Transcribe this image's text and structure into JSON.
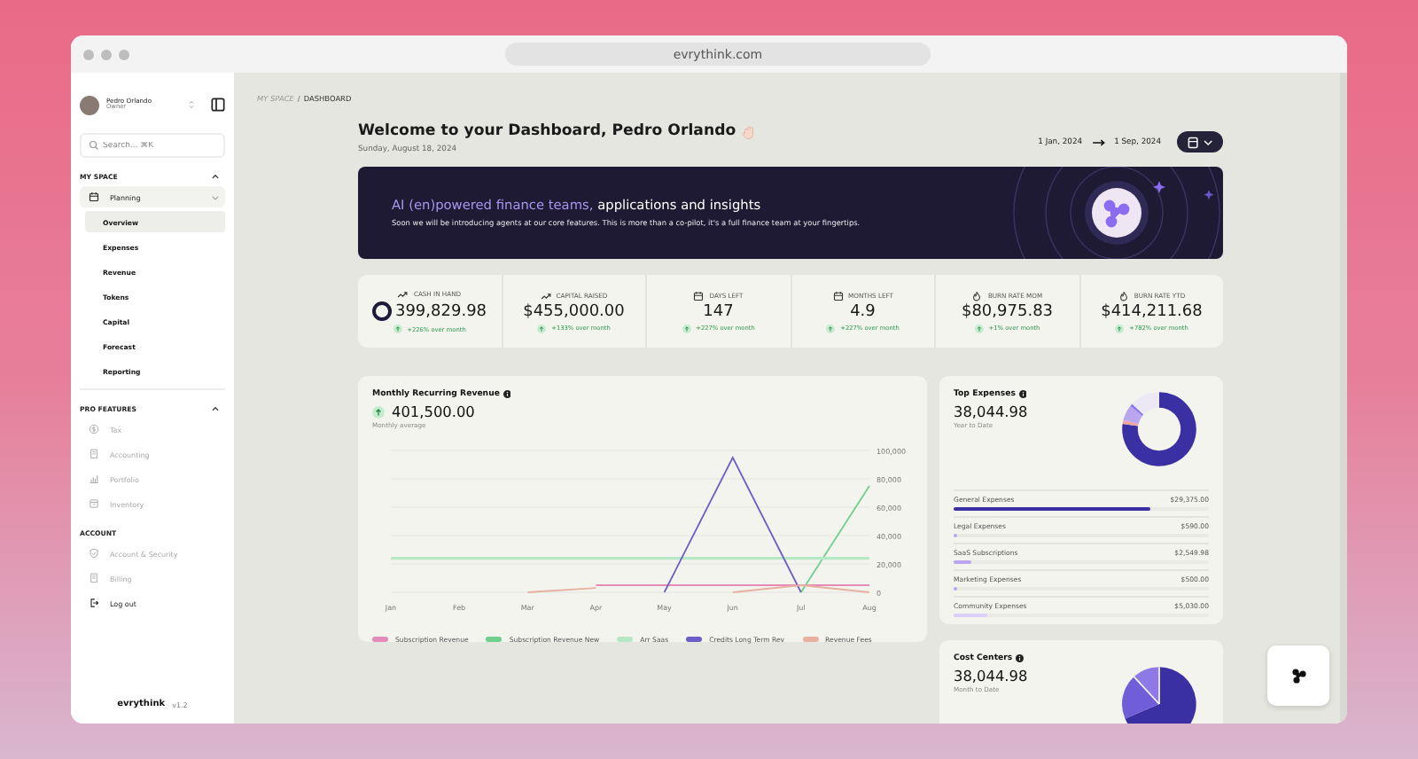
{
  "browser": {
    "url": "evrythink.com"
  },
  "sidebar": {
    "user": {
      "name": "Pedro Orlando",
      "role": "Owner"
    },
    "search": {
      "placeholder": "Search... ⌘K"
    },
    "sections": [
      {
        "title": "MY SPACE",
        "expanded": true,
        "items": [
          {
            "label": "Planning",
            "disabled": false,
            "expanded": true,
            "children": [
              {
                "label": "Overview",
                "selected": true
              },
              {
                "label": "Expenses",
                "selected": false
              },
              {
                "label": "Revenue",
                "selected": false
              },
              {
                "label": "Tokens",
                "selected": false
              },
              {
                "label": "Capital",
                "selected": false
              },
              {
                "label": "Forecast",
                "selected": false
              },
              {
                "label": "Reporting",
                "selected": false
              }
            ]
          }
        ]
      },
      {
        "title": "PRO FEATURES",
        "expanded": true,
        "items": [
          {
            "label": "Tax",
            "disabled": true
          },
          {
            "label": "Accounting",
            "disabled": true
          },
          {
            "label": "Portfolio",
            "disabled": true
          },
          {
            "label": "Inventory",
            "disabled": true
          }
        ]
      },
      {
        "title": "ACCOUNT",
        "items": [
          {
            "label": "Account & Security",
            "disabled": true
          },
          {
            "label": "Billing",
            "disabled": true
          },
          {
            "label": "Log out",
            "disabled": false
          }
        ]
      }
    ],
    "footer": {
      "logo": "evrythink",
      "version": "v1.2"
    }
  },
  "breadcrumb": {
    "separator": "/",
    "items": [
      {
        "label": "MY SPACE",
        "current": false
      },
      {
        "label": "DASHBOARD",
        "current": true
      }
    ]
  },
  "header": {
    "title": "Welcome to your Dashboard, Pedro Orlando",
    "date": "Sunday, August 18, 2024",
    "range_start": "1 Jan, 2024",
    "range_end": "1 Sep, 2024"
  },
  "banner": {
    "title_accent": "AI (en)powered finance teams,",
    "title_rest": "applications and insights",
    "text": "Soon we will be introducing agents at our core features. This is more than a co-pilot, it's a full finance team at your fingertips."
  },
  "stats": [
    {
      "label": "CASH IN HAND",
      "value": "399,829.98",
      "change": "+226% over month",
      "cursor": true
    },
    {
      "label": "CAPITAL RAISED",
      "value": "$455,000.00",
      "change": "+133% over month"
    },
    {
      "label": "DAYS LEFT",
      "value": "147",
      "change": "+227% over month"
    },
    {
      "label": "MONTHS LEFT",
      "value": "4.9",
      "change": "+227% over month"
    },
    {
      "label": "BURN RATE MOM",
      "value": "$80,975.83",
      "change": "+1% over month"
    },
    {
      "label": "BURN RATE YTD",
      "value": "$414,211.68",
      "change": "+782% over month"
    }
  ],
  "mrr": {
    "title": "Monthly Recurring Revenue",
    "value": "401,500.00",
    "subtitle": "Monthly average",
    "chart_data": {
      "type": "line",
      "grid": true,
      "categories": [
        "Jan",
        "Feb",
        "Mar",
        "Apr",
        "May",
        "Jun",
        "Jul",
        "Aug"
      ],
      "ylim": [
        0,
        100000
      ],
      "yticks": [
        0,
        {
          "value": 20000,
          "label": "20,000"
        },
        {
          "value": 40000,
          "label": "40,000"
        },
        {
          "value": 60000,
          "label": "60,000"
        },
        {
          "value": 80000,
          "label": "80,000"
        },
        {
          "value": 100000,
          "label": "100,000"
        }
      ],
      "series": [
        {
          "name": "Subscription Revenue",
          "color": "#e58bb8",
          "values": [
            null,
            null,
            null,
            5000,
            5000,
            5000,
            5000,
            5000
          ]
        },
        {
          "name": "Subscription Revenue New",
          "color": "#6fcf8f",
          "values": [
            null,
            null,
            null,
            null,
            null,
            null,
            0,
            75000
          ]
        },
        {
          "name": "Arr Saas",
          "color": "#b6e8c6",
          "values": [
            24000,
            24000,
            24000,
            24000,
            24000,
            24000,
            24000,
            24000
          ]
        },
        {
          "name": "Credits Long Term Rev",
          "color": "#6c5fc7",
          "values": [
            null,
            null,
            null,
            null,
            0,
            95000,
            0,
            null
          ]
        },
        {
          "name": "Revenue Fees",
          "color": "#e8b0a0",
          "values": [
            null,
            null,
            0,
            3000,
            null,
            0,
            5000,
            0
          ]
        }
      ]
    }
  },
  "top_expenses": {
    "title": "Top Expenses",
    "value": "38,044.98",
    "subtitle": "Year to Date",
    "items": [
      {
        "label": "General Expenses",
        "amount": "$29,375.00",
        "level": 0.77,
        "color": "#3a2fa3"
      },
      {
        "label": "Legal Expenses",
        "amount": "$590.00",
        "level": 0.016,
        "color": "#b9a6ee"
      },
      {
        "label": "SaaS Subscriptions",
        "amount": "$2,549.98",
        "level": 0.067,
        "color": "#b9a6ee"
      },
      {
        "label": "Marketing Expenses",
        "amount": "$500.00",
        "level": 0.013,
        "color": "#b9a6ee"
      },
      {
        "label": "Community Expenses",
        "amount": "$5,030.00",
        "level": 0.13,
        "color": "#d9cff7"
      }
    ]
  },
  "cost_centers": {
    "title": "Cost Centers",
    "value": "38,044.98",
    "subtitle": "Month to Date"
  }
}
